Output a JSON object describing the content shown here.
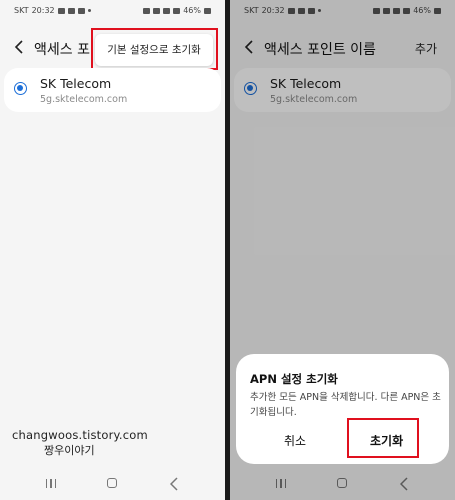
{
  "status_bar": {
    "carrier": "SKT",
    "time": "20:32",
    "battery": "46%"
  },
  "left_screen": {
    "title": "액세스 포",
    "menu_item": "기본 설정으로 초기화",
    "apn": {
      "name": "SK Telecom",
      "sub": "5g.sktelecom.com"
    },
    "watermark": {
      "line1": "changwoos.tistory.com",
      "line2": "짱우이야기"
    }
  },
  "right_screen": {
    "title": "액세스 포인트 이름",
    "add_label": "추가",
    "apn": {
      "name": "SK Telecom",
      "sub": "5g.sktelecom.com"
    },
    "dialog": {
      "title": "APN 설정 초기화",
      "message": "추가한 모든 APN을 삭제합니다. 다른 APN은 초기화됩니다.",
      "cancel": "취소",
      "confirm": "초기화"
    }
  },
  "colors": {
    "highlight": "#e0101e",
    "radio": "#1d6fd8",
    "background": "#f5f5f5"
  }
}
